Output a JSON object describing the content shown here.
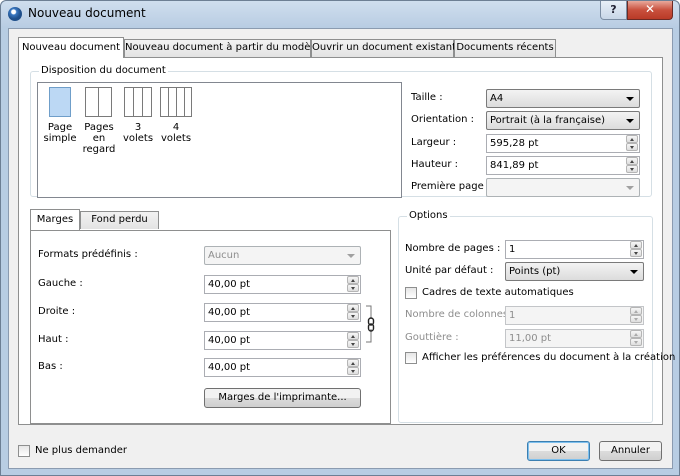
{
  "window": {
    "title": "Nouveau document",
    "help_label": "?",
    "close_label": "✕"
  },
  "tabs": [
    {
      "label": "Nouveau document",
      "active": true
    },
    {
      "label": "Nouveau document à partir du modèle",
      "active": false
    },
    {
      "label": "Ouvrir un document existant",
      "active": false
    },
    {
      "label": "Documents récents",
      "active": false
    }
  ],
  "layout_group": {
    "title": "Disposition du document",
    "options": [
      {
        "label": "Page simple",
        "selected": true
      },
      {
        "label": "Pages en regard",
        "selected": false
      },
      {
        "label": "3 volets",
        "selected": false
      },
      {
        "label": "4 volets",
        "selected": false
      }
    ]
  },
  "page_props": {
    "size_label": "Taille :",
    "size_value": "A4",
    "orientation_label": "Orientation :",
    "orientation_value": "Portrait (à la française)",
    "width_label": "Largeur :",
    "width_value": "595,28 pt",
    "height_label": "Hauteur :",
    "height_value": "841,89 pt",
    "first_page_label": "Première page :",
    "first_page_value": ""
  },
  "margins": {
    "tabs": [
      "Marges",
      "Fond perdu"
    ],
    "presets_label": "Formats prédéfinis :",
    "presets_value": "Aucun",
    "left_label": "Gauche :",
    "left_value": "40,00 pt",
    "right_label": "Droite :",
    "right_value": "40,00 pt",
    "top_label": "Haut :",
    "top_value": "40,00 pt",
    "bottom_label": "Bas :",
    "bottom_value": "40,00 pt",
    "printer_margins_button": "Marges de l'imprimante..."
  },
  "options": {
    "title": "Options",
    "pages_label": "Nombre de pages :",
    "pages_value": "1",
    "unit_label": "Unité par défaut :",
    "unit_value": "Points (pt)",
    "auto_frames_label": "Cadres de texte automatiques",
    "columns_label": "Nombre de colonnes :",
    "columns_value": "1",
    "gutter_label": "Gouttière :",
    "gutter_value": "11,00 pt",
    "show_prefs_label": "Afficher les préférences du document à la création"
  },
  "footer": {
    "dont_ask_label": "Ne plus demander",
    "ok_label": "OK",
    "cancel_label": "Annuler"
  },
  "colors": {
    "frame": "#b8cde3",
    "selected_page": "#bcd8f4",
    "close_button": "#c9503d"
  }
}
